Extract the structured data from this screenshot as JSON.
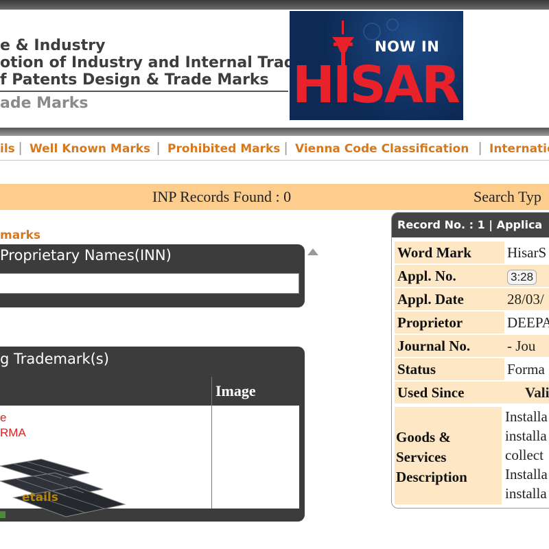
{
  "header": {
    "org_line1": "e & Industry",
    "org_line2": "otion of Industry and Internal Trade",
    "org_line3": "f Patents Design & Trade Marks",
    "org_line4": "ade Marks",
    "banner": {
      "top_text": "NOW IN",
      "main_text": "HISAR"
    }
  },
  "nav": {
    "items": [
      "ils",
      "Well Known Marks",
      "Prohibited Marks",
      "Vienna Code Classification",
      "Internatio"
    ],
    "separator": "|"
  },
  "results_bar": {
    "records_found": "INP Records Found : 0",
    "search_type": "Search Typ"
  },
  "left": {
    "section_link": "marks",
    "inn_panel_title": "Proprietary Names(INN)",
    "tm_panel_title": "g Trademark(s)",
    "image_header": "Image",
    "row_line1": "e",
    "row_line2": "RMA",
    "row_details": "etails"
  },
  "record": {
    "header": "Record No. : 1 | Applica",
    "rows": [
      {
        "label": "Word Mark",
        "value": "HisarS"
      },
      {
        "label": "Appl. No.",
        "value": "3:28"
      },
      {
        "label": "Appl. Date",
        "value": "28/03/"
      },
      {
        "label": "Proprietor",
        "value": "DEEPA"
      },
      {
        "label": "Journal No.",
        "value": "-   Jou"
      },
      {
        "label": "Status",
        "value": "Forma"
      },
      {
        "label": "Used Since",
        "value": "Vali"
      }
    ],
    "goods_label": "Goods & Services Description",
    "goods_lines": [
      "Installa",
      "installa",
      "collect",
      "Installa",
      "installa"
    ]
  },
  "colors": {
    "nav_link": "#d7781c",
    "results_bar": "#fccd8c",
    "panel_dark": "#3c3c3c",
    "label_bg": "#fde7c4",
    "banner_red": "#e8212b",
    "banner_blue": "#0c2a55"
  }
}
